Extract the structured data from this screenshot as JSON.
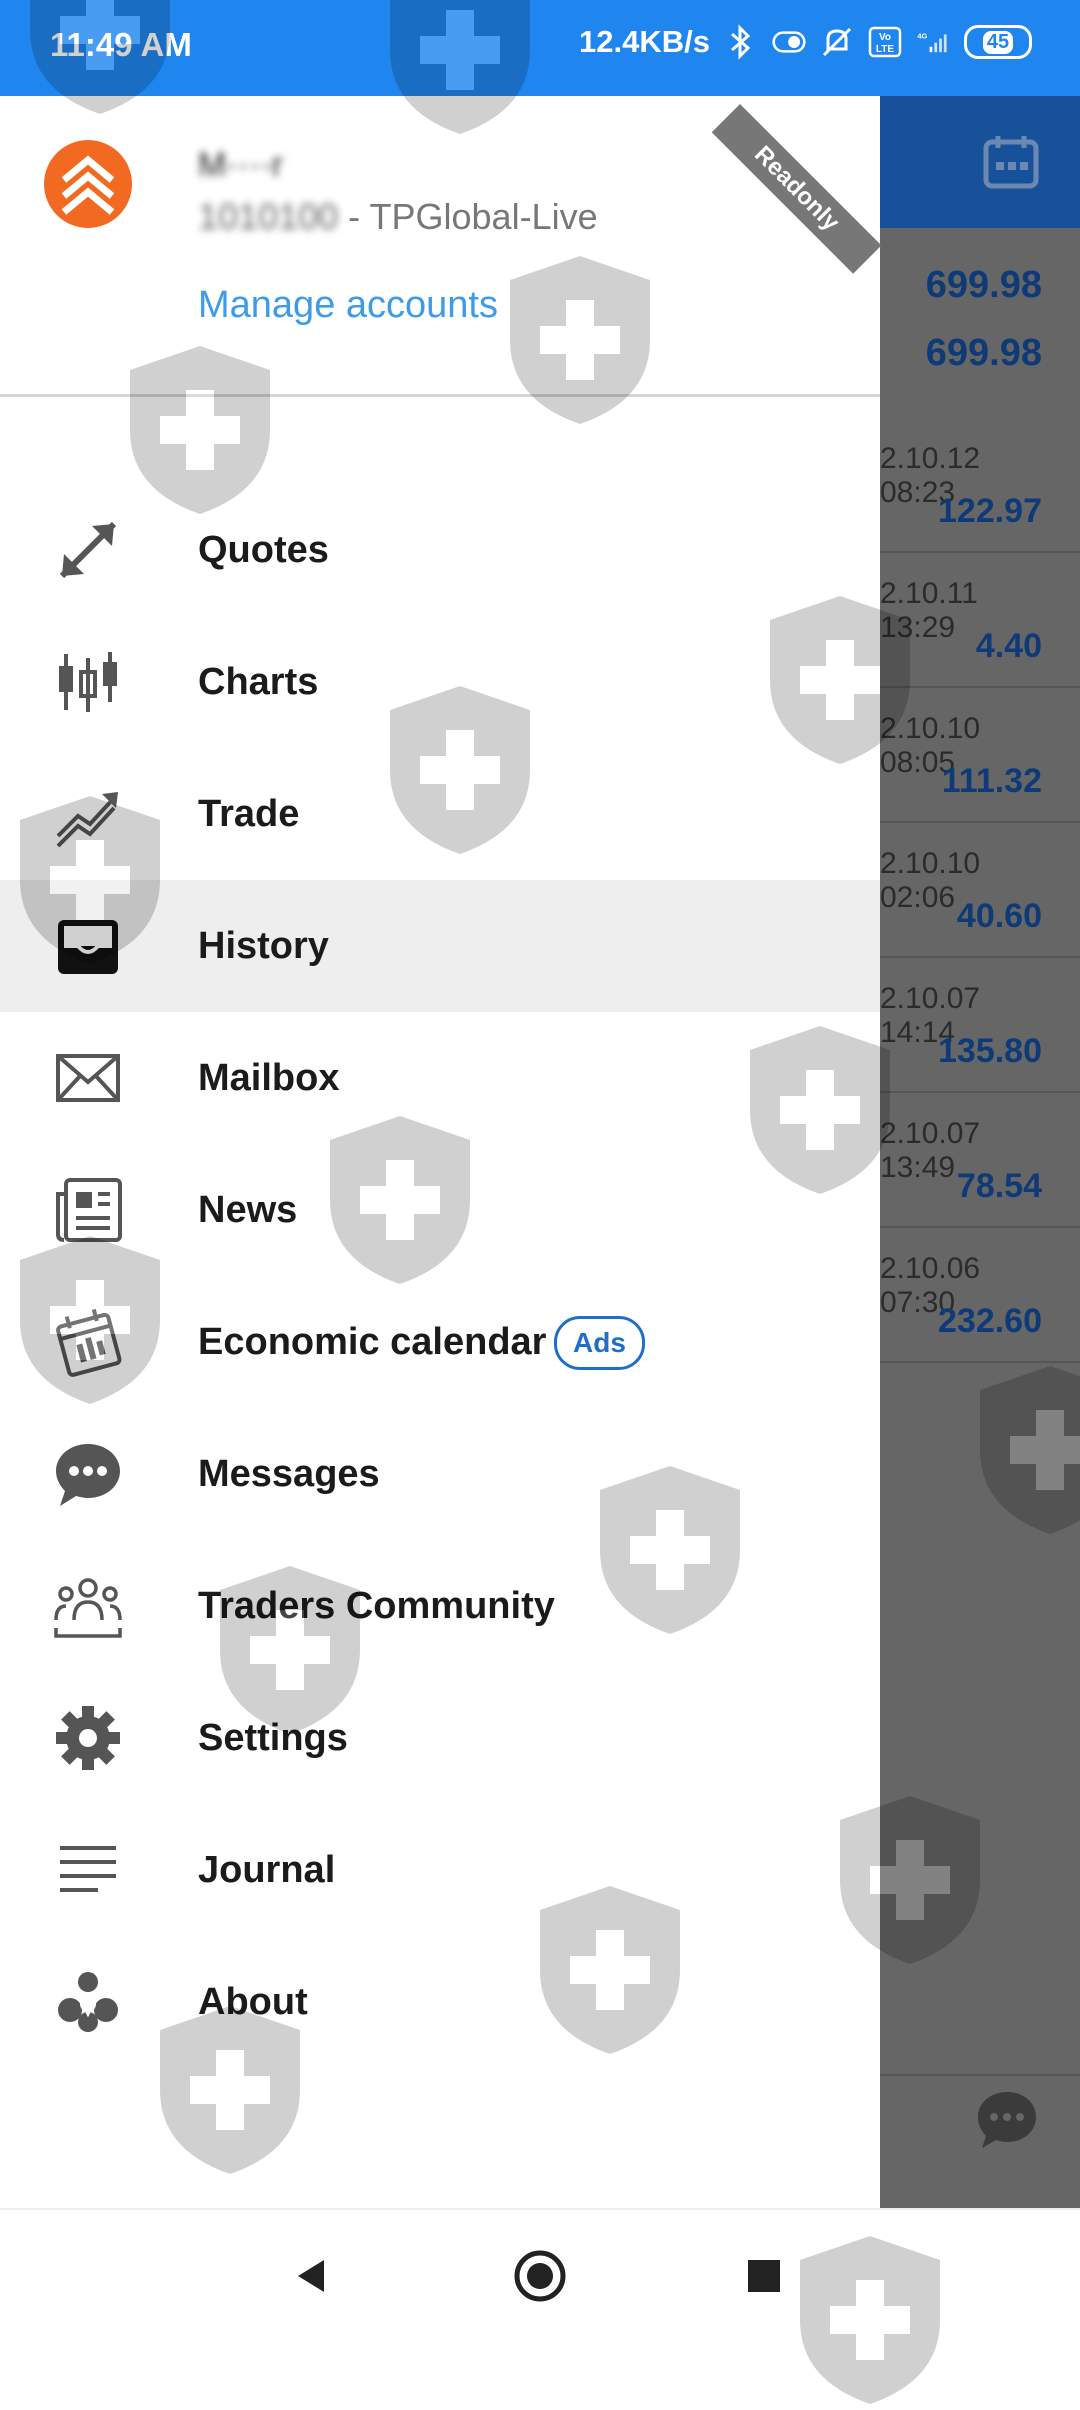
{
  "status_bar": {
    "time": "11:49 AM",
    "net_speed": "12.4KB/s",
    "battery": "45",
    "network": "4G",
    "volte": "Vo LTE"
  },
  "account": {
    "name": "M····r",
    "number_masked": "1010100",
    "server": " - TPGlobal-Live",
    "manage_label": "Manage accounts",
    "badge": "Readonly"
  },
  "menu": [
    {
      "label": "Quotes",
      "icon": "quotes-arrows-icon"
    },
    {
      "label": "Charts",
      "icon": "candlestick-icon"
    },
    {
      "label": "Trade",
      "icon": "trade-trend-icon"
    },
    {
      "label": "History",
      "icon": "history-inbox-icon",
      "active": true
    },
    {
      "label": "Mailbox",
      "icon": "mail-icon"
    },
    {
      "label": "News",
      "icon": "newspaper-icon"
    },
    {
      "label": "Economic calendar",
      "icon": "calendar-icon",
      "badge": "Ads"
    },
    {
      "label": "Messages",
      "icon": "chat-bubble-icon"
    },
    {
      "label": "Traders Community",
      "icon": "community-icon"
    },
    {
      "label": "Settings",
      "icon": "gear-icon"
    },
    {
      "label": "Journal",
      "icon": "journal-lines-icon"
    },
    {
      "label": "About",
      "icon": "about-logo-icon"
    }
  ],
  "background_list": {
    "top_values": [
      "699.98",
      "699.98"
    ],
    "rows": [
      {
        "date": "2.10.12 08:23",
        "value": "122.97"
      },
      {
        "date": "2.10.11 13:29",
        "value": "4.40"
      },
      {
        "date": "2.10.10 08:05",
        "value": "111.32"
      },
      {
        "date": "2.10.10 02:06",
        "value": "40.60"
      },
      {
        "date": "2.10.07 14:14",
        "value": "135.80"
      },
      {
        "date": "2.10.07 13:49",
        "value": "78.54"
      },
      {
        "date": "2.10.06 07:30",
        "value": "232.60"
      }
    ]
  },
  "colors": {
    "status_bar": "#1f86f0",
    "accent_blue": "#3d9be9",
    "ads_blue": "#1f6ec7",
    "logo_orange": "#f26a22",
    "value_blue": "#0f3a78"
  }
}
